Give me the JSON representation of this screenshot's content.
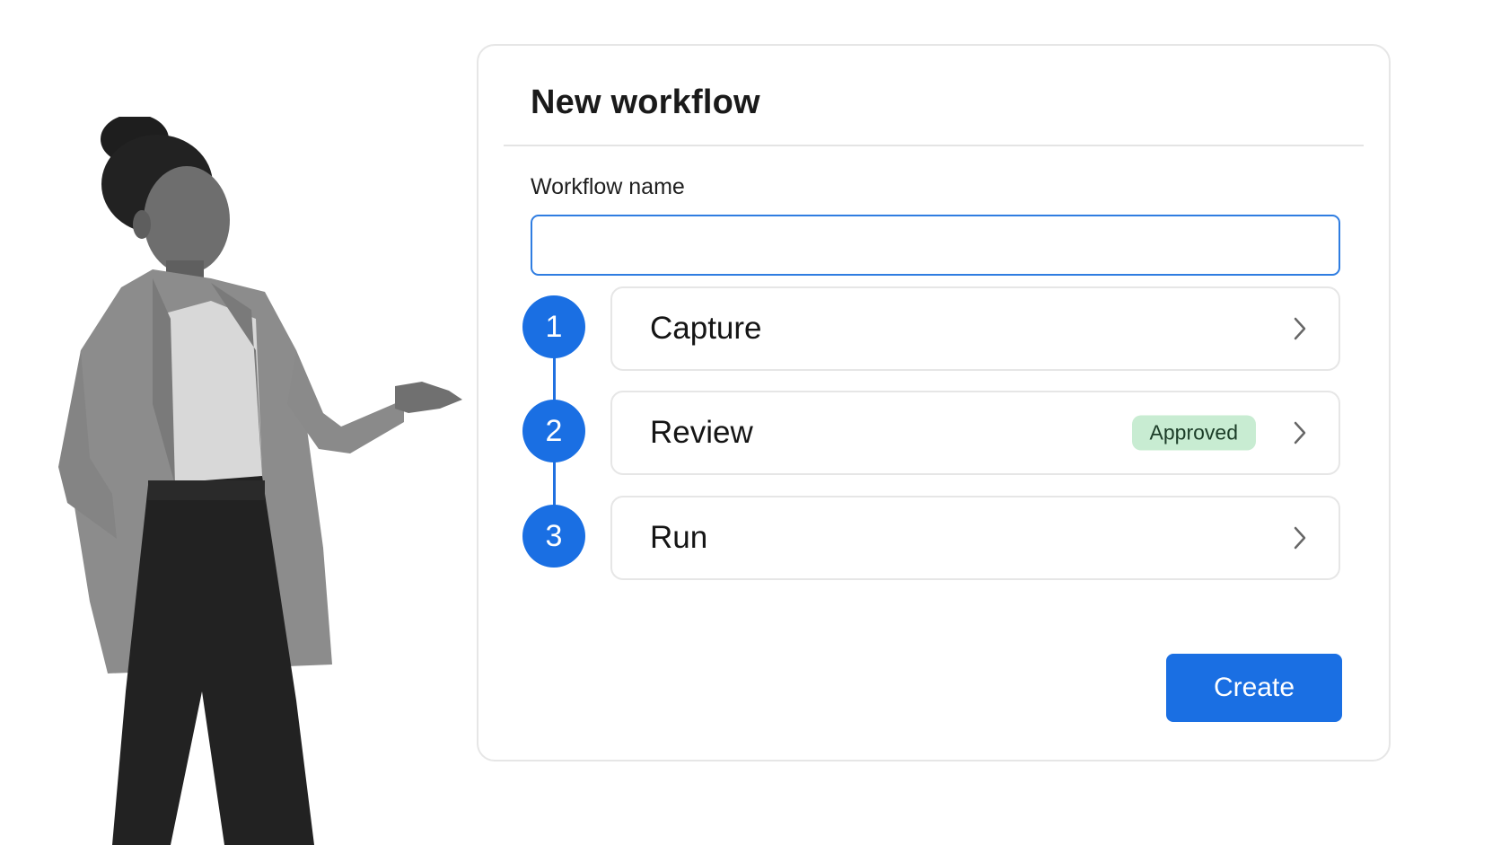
{
  "card": {
    "title": "New workflow",
    "name_label": "Workflow name",
    "name_value": "",
    "name_placeholder": ""
  },
  "steps": [
    {
      "number": "1",
      "label": "Capture",
      "badge": ""
    },
    {
      "number": "2",
      "label": "Review",
      "badge": "Approved"
    },
    {
      "number": "3",
      "label": "Run",
      "badge": ""
    }
  ],
  "actions": {
    "create_label": "Create"
  },
  "icons": {
    "chevron": "chevron-right-icon"
  },
  "colors": {
    "accent": "#1a6fe3",
    "input_border": "#2f7de1",
    "badge_bg": "#c8ecd2",
    "badge_text": "#1c3d28",
    "card_border": "#e6e6e6"
  }
}
